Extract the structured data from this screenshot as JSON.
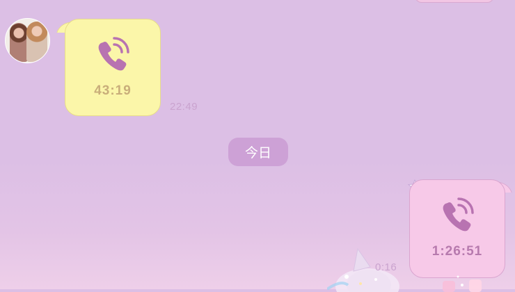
{
  "chat": {
    "incoming_call": {
      "duration": "43:19",
      "time": "22:49"
    },
    "date_divider": "今日",
    "outgoing_call": {
      "duration": "1:26:51",
      "time": "0:16"
    }
  },
  "icons": {
    "call": "phone-call-icon",
    "avatar": "contact-avatar",
    "sticker": "shooting-star-sticker"
  },
  "colors": {
    "background": "#dcbfe5",
    "incoming_bubble": "#fbf6a9",
    "outgoing_bubble": "#f7c9e8",
    "phone_icon": "#b873b1",
    "date_chip": "#cda1d6"
  }
}
